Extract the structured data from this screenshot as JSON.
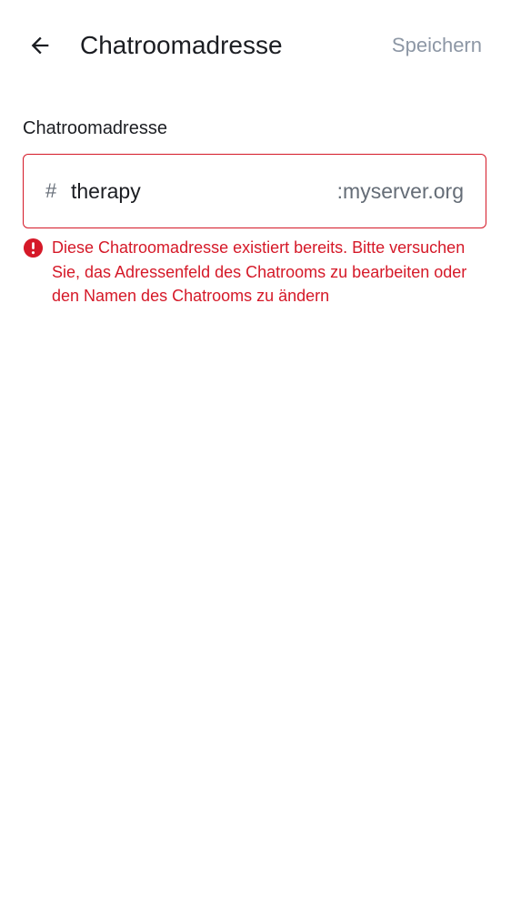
{
  "header": {
    "title": "Chatroomadresse",
    "save_label": "Speichern",
    "back_icon": "arrow-left-icon"
  },
  "form": {
    "label": "Chatroomadresse",
    "prefix": "#",
    "value": "therapy",
    "suffix": ":myserver.org",
    "error_icon": "error-circle-icon",
    "error_message": "Diese Chatroomadresse existiert bereits. Bitte versuchen Sie, das Adressenfeld des Chatrooms zu bearbeiten oder den Namen des Chatrooms zu ändern"
  },
  "colors": {
    "error": "#d51928",
    "disabled_action": "#8d97a5",
    "text_primary": "#1b1d22",
    "text_secondary": "#656d77"
  }
}
